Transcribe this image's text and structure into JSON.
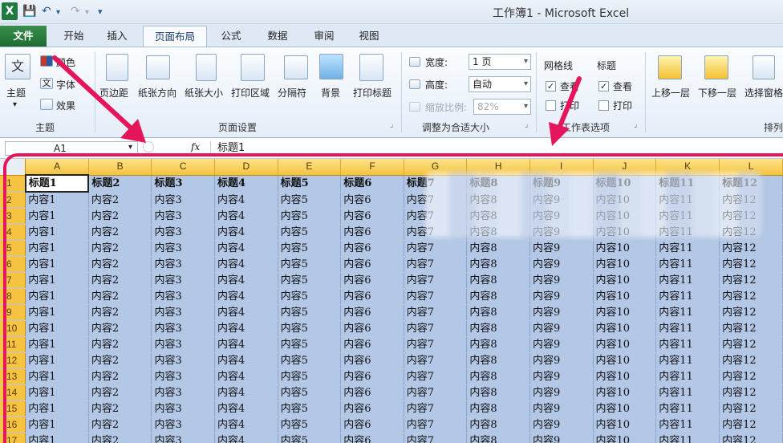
{
  "titlebar": {
    "title": "工作簿1 - Microsoft Excel",
    "logo": "X",
    "save_icon": "save-icon",
    "undo_icon": "undo-icon",
    "redo_icon": "redo-icon"
  },
  "tabs": [
    "文件",
    "开始",
    "插入",
    "页面布局",
    "公式",
    "数据",
    "审阅",
    "视图"
  ],
  "active_tab": "页面布局",
  "ribbon": {
    "theme": {
      "main": "主题",
      "colors": "颜色",
      "fonts": "字体",
      "effects": "效果",
      "group": "主题"
    },
    "page_setup": {
      "margins": "页边距",
      "orientation": "纸张方向",
      "size": "纸张大小",
      "print_area": "打印区域",
      "breaks": "分隔符",
      "background": "背景",
      "print_titles": "打印标题",
      "group": "页面设置"
    },
    "scale": {
      "width_label": "宽度:",
      "width_value": "1 页",
      "height_label": "高度:",
      "height_value": "自动",
      "scale_label": "缩放比例:",
      "scale_value": "82%",
      "group": "调整为合适大小"
    },
    "sheet_options": {
      "gridlines": "网格线",
      "headings": "标题",
      "view1": "查看",
      "print1": "打印",
      "view2": "查看",
      "print2": "打印",
      "group": "工作表选项"
    },
    "arrange": {
      "bring_forward": "上移一层",
      "send_backward": "下移一层",
      "selection_pane": "选择窗格",
      "group": "排列"
    }
  },
  "formula_bar": {
    "name_box": "A1",
    "fx": "fx",
    "content": "标题1"
  },
  "sheet": {
    "columns": [
      "A",
      "B",
      "C",
      "D",
      "E",
      "F",
      "G",
      "H",
      "I",
      "J",
      "K",
      "L"
    ],
    "row_numbers": [
      "1",
      "2",
      "3",
      "4",
      "5",
      "6",
      "7",
      "8",
      "9",
      "10",
      "11",
      "12",
      "13",
      "14",
      "15",
      "16",
      "17"
    ],
    "header_row": [
      "标题1",
      "标题2",
      "标题3",
      "标题4",
      "标题5",
      "标题6",
      "标题7",
      "标题8",
      "标题9",
      "标题10",
      "标题11",
      "标题12"
    ],
    "data_row": [
      "内容1",
      "内容2",
      "内容3",
      "内容4",
      "内容5",
      "内容6",
      "内容7",
      "内容8",
      "内容9",
      "内容10",
      "内容11",
      "内容12"
    ]
  },
  "colors": {
    "highlight_frame": "#e4155b",
    "selection": "#b3c7e6",
    "row_header": "#f6c343"
  }
}
